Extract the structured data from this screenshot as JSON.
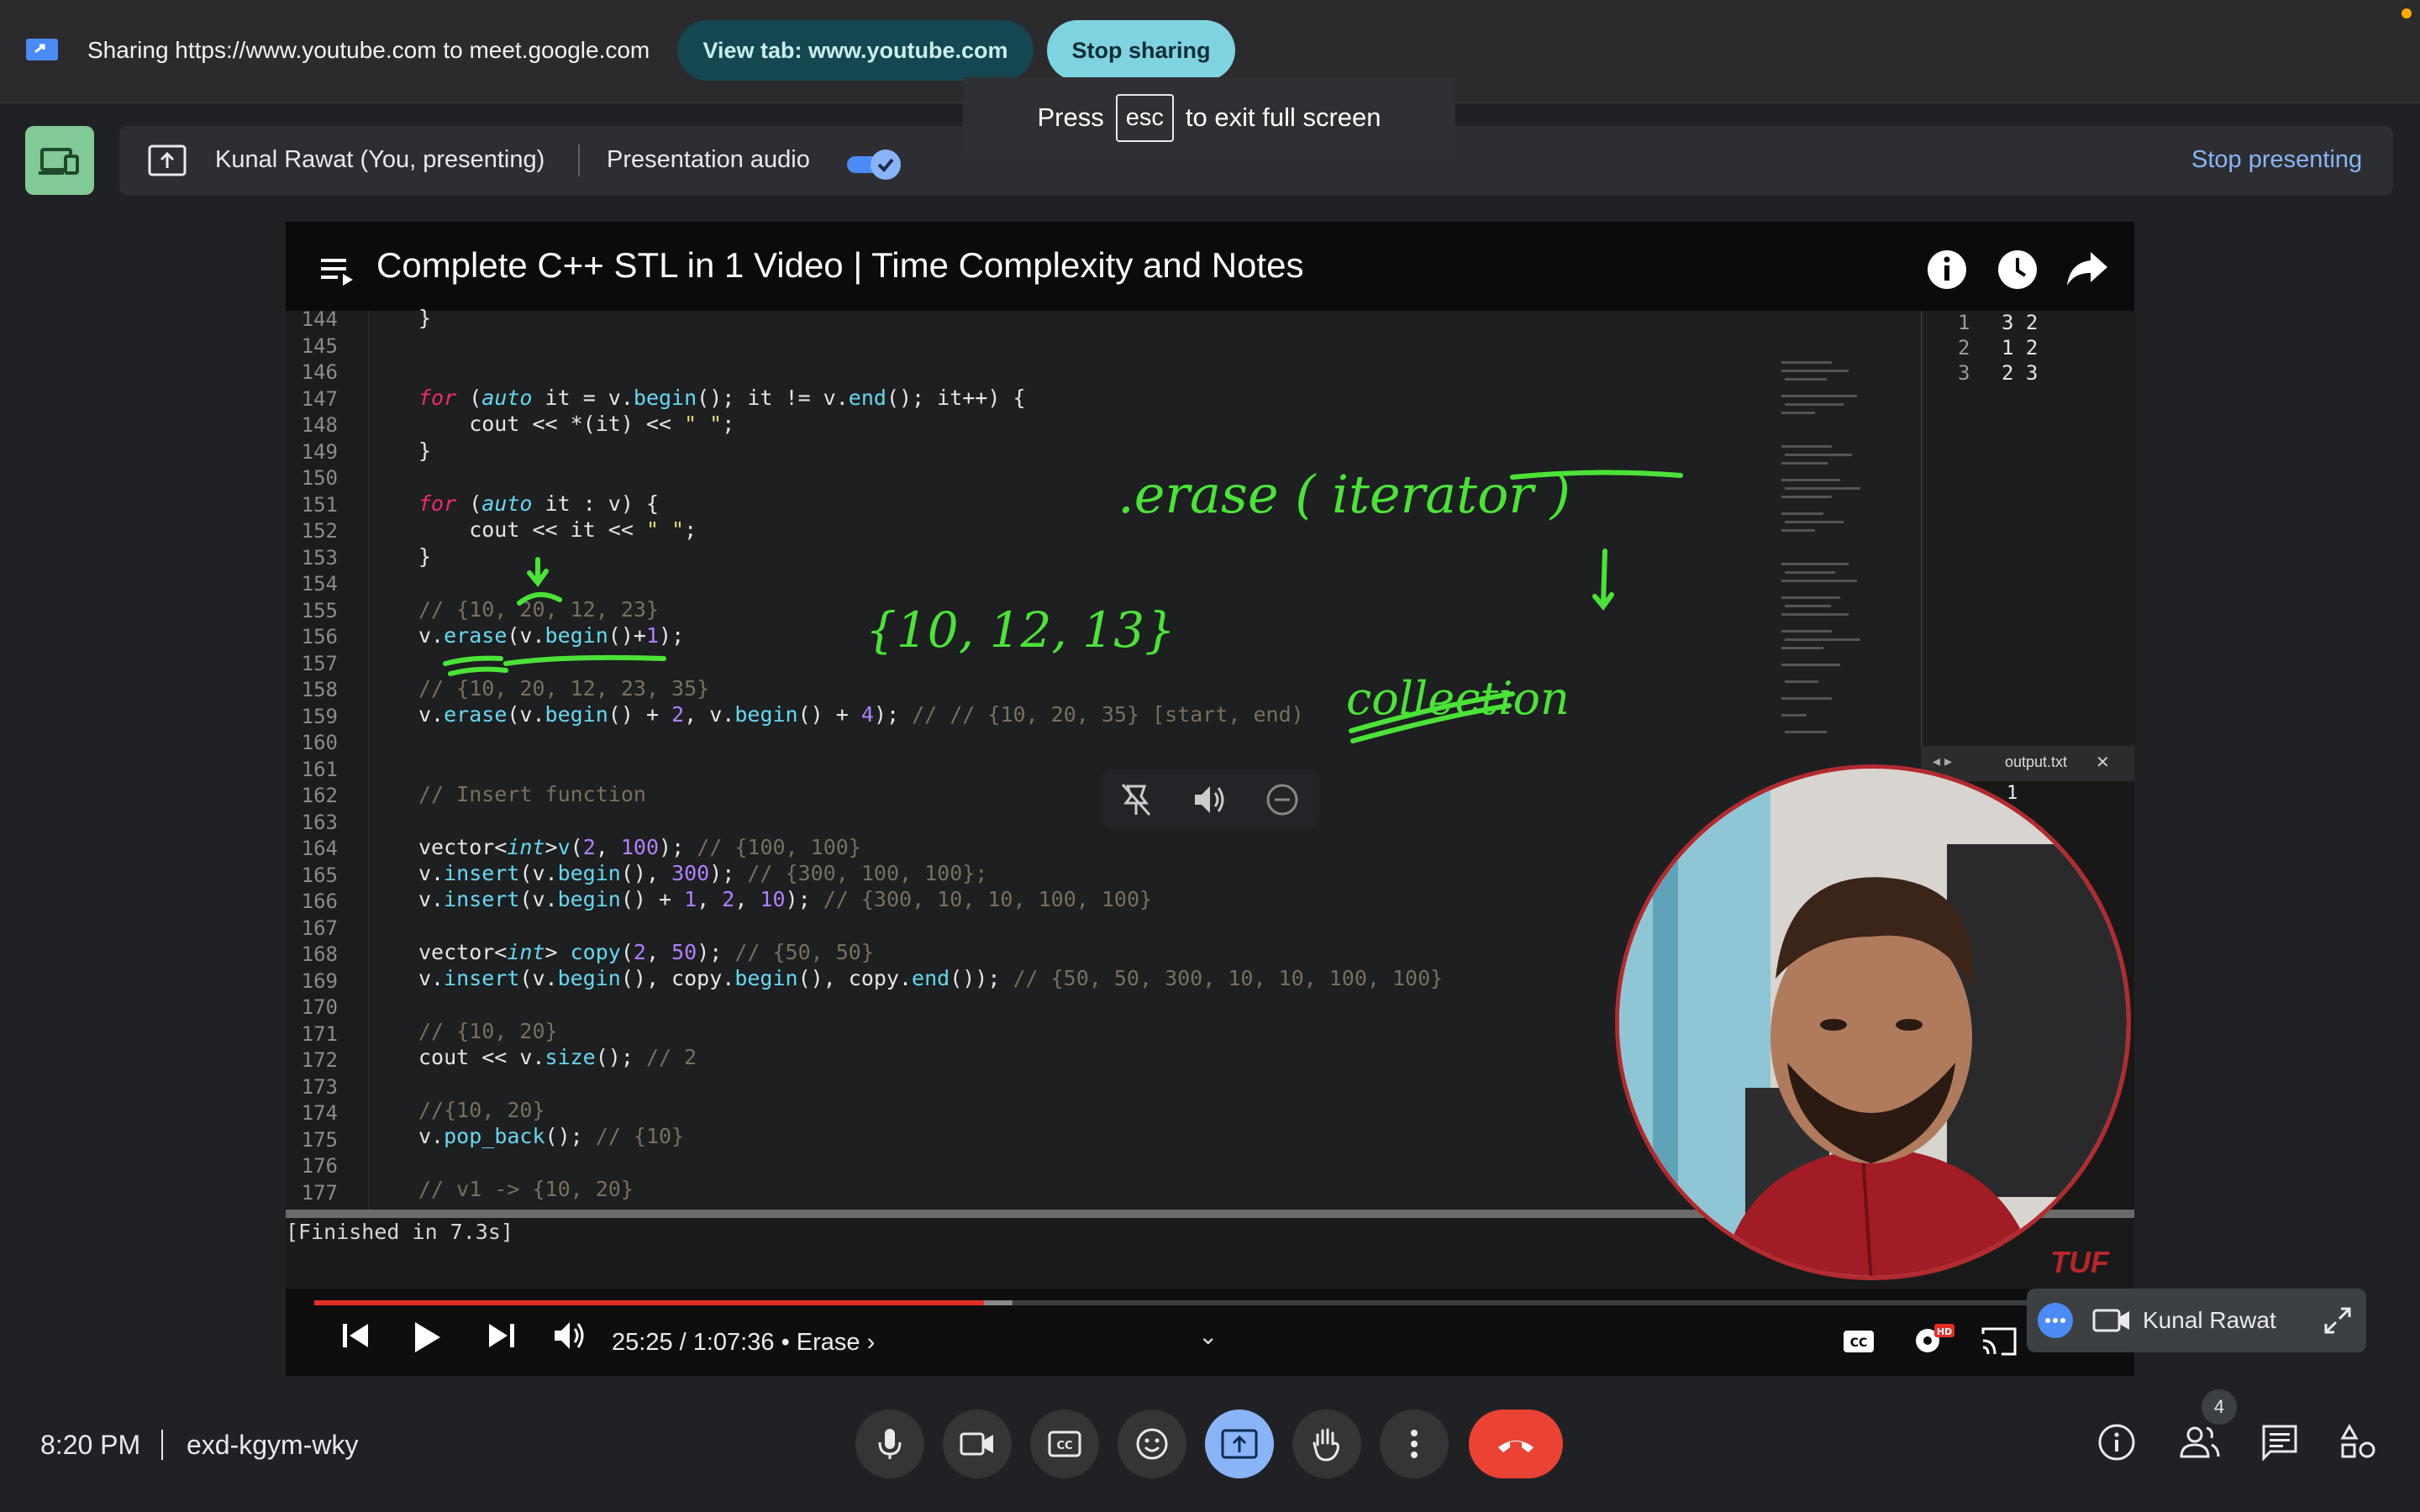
{
  "share_bar": {
    "text": "Sharing https://www.youtube.com to meet.google.com",
    "view_tab_label": "View tab: www.youtube.com",
    "stop_sharing_label": "Stop sharing"
  },
  "fullscreen_hint": {
    "press": "Press",
    "key": "esc",
    "rest": "to exit full screen"
  },
  "presenting_bar": {
    "presenter": "Kunal Rawat (You, presenting)",
    "audio_label": "Presentation audio",
    "audio_enabled": true,
    "stop_presenting_label": "Stop presenting"
  },
  "video": {
    "title": "Complete C++ STL in 1 Video | Time Complexity and Notes",
    "line_numbers": [
      "144",
      "145",
      "146",
      "147",
      "148",
      "149",
      "150",
      "151",
      "152",
      "153",
      "154",
      "155",
      "156",
      "157",
      "158",
      "159",
      "160",
      "161",
      "162",
      "163",
      "164",
      "165",
      "166",
      "167",
      "168",
      "169",
      "170",
      "171",
      "172",
      "173",
      "174",
      "175",
      "176",
      "177"
    ],
    "code": {
      "l144": "}",
      "l147": [
        "for",
        " (",
        "auto",
        " it = v.",
        "begin",
        "(); it != v.",
        "end",
        "(); it++) {"
      ],
      "l148": [
        "    cout << *(it) << ",
        "\" \"",
        ";"
      ],
      "l149": "}",
      "l151": [
        "for",
        " (",
        "auto",
        " it : v) {"
      ],
      "l152": [
        "    cout << it << ",
        "\" \"",
        ";"
      ],
      "l153": "}",
      "l155": "// {10, 20, 12, 23}",
      "l156": [
        "v.",
        "erase",
        "(v.",
        "begin",
        "()+",
        "1",
        ");"
      ],
      "l158": "// {10, 20, 12, 23, 35}",
      "l159": [
        "v.",
        "erase",
        "(v.",
        "begin",
        "() + ",
        "2",
        ", v.",
        "begin",
        "() + ",
        "4",
        "); ",
        "// // {10, 20, 35} [start, end)"
      ],
      "l162": "// Insert function",
      "l164": [
        "vector<",
        "int",
        ">",
        "v",
        "(",
        "2",
        ", ",
        "100",
        "); ",
        "// {100, 100}"
      ],
      "l165": [
        "v.",
        "insert",
        "(v.",
        "begin",
        "(), ",
        "300",
        "); ",
        "// {300, 100, 100};"
      ],
      "l166": [
        "v.",
        "insert",
        "(v.",
        "begin",
        "() + ",
        "1",
        ", ",
        "2",
        ", ",
        "10",
        "); ",
        "// {300, 10, 10, 100, 100}"
      ],
      "l168": [
        "vector<",
        "int",
        "> ",
        "copy",
        "(",
        "2",
        ", ",
        "50",
        "); ",
        "// {50, 50}"
      ],
      "l169": [
        "v.",
        "insert",
        "(v.",
        "begin",
        "(), copy.",
        "begin",
        "(), copy.",
        "end",
        "()); ",
        "// {50, 50, 300, 10, 10, 100, 100}"
      ],
      "l171": "// {10, 20}",
      "l172": [
        "cout << v.",
        "size",
        "(); ",
        "// 2"
      ],
      "l174": "//{10, 20}",
      "l175": [
        "v.",
        "pop_back",
        "(); ",
        "// {10}"
      ],
      "l177": "// v1 -> {10, 20}"
    },
    "output_panel": {
      "rows": [
        {
          "n": "1",
          "t": "3 2"
        },
        {
          "n": "2",
          "t": "1 2"
        },
        {
          "n": "3",
          "t": "2 3"
        }
      ],
      "tab_label": "output.txt",
      "value": "1"
    },
    "annotations": {
      "erase_note": ".erase ( iterator )",
      "collection_note": "{10, 12, 13}",
      "result_note": "collection"
    },
    "console": "[Finished in 7.3s]",
    "watermark": "TUF",
    "player": {
      "time": "25:25 / 1:07:36",
      "chapter": "• Erase ›",
      "progress_fraction": 0.374,
      "buffered_fraction": 0.39
    }
  },
  "participant_tile": {
    "name": "Kunal Rawat"
  },
  "bottom_bar": {
    "time": "8:20 PM",
    "meeting_code": "exd-kgym-wky",
    "people_count": "4"
  },
  "colors": {
    "accent": "#8ab4f8",
    "end_call": "#ea4335",
    "present_active": "#8ab4f8",
    "stop_sharing": "#7fd3e0"
  }
}
